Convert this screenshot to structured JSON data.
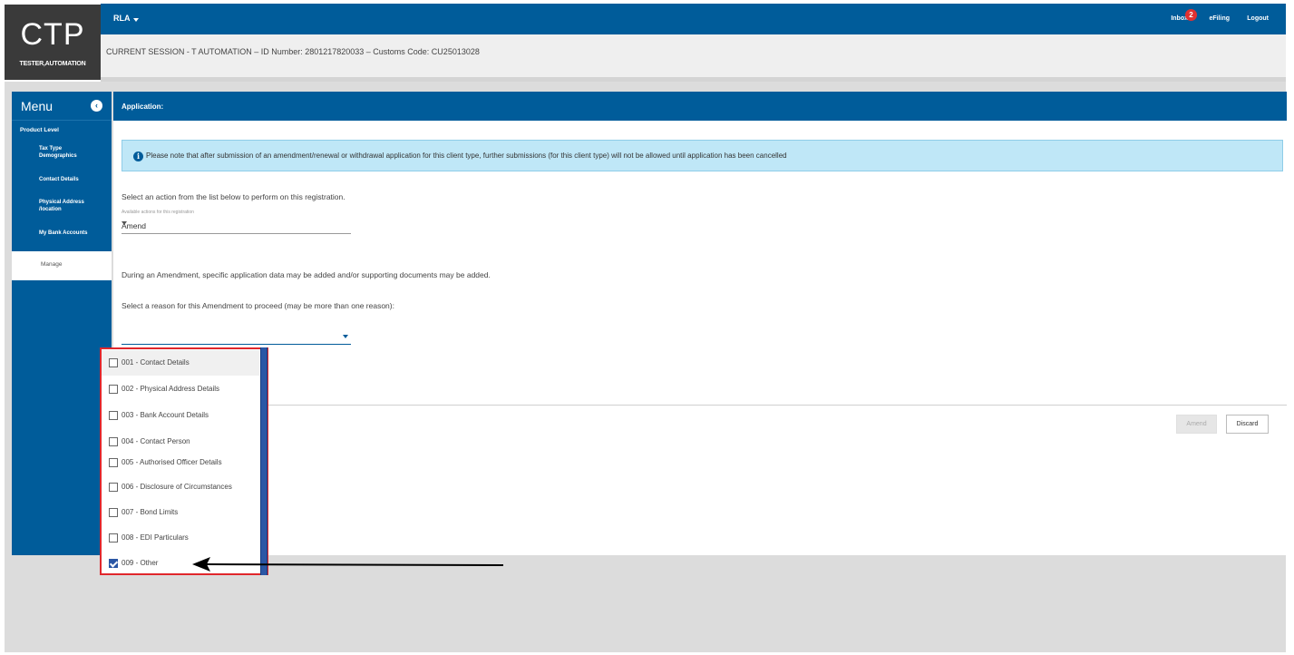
{
  "logo": {
    "brand": "CTP",
    "user": "TESTER,AUTOMATION"
  },
  "topbar": {
    "rla": "RLA",
    "inbox": "Inbox",
    "inbox_count": "2",
    "efiling": "eFiling",
    "logout": "Logout"
  },
  "session": {
    "text": "CURRENT SESSION - T AUTOMATION – ID Number: 2801217820033 – Customs Code: CU25013028"
  },
  "sidebar": {
    "title": "Menu",
    "section": "Product Level",
    "items": [
      {
        "label": "Tax Type Demographics"
      },
      {
        "label": "Contact Details"
      },
      {
        "label": "Physical Address /location"
      },
      {
        "label": "My Bank Accounts"
      },
      {
        "label": "Manage"
      }
    ]
  },
  "content": {
    "header": "Application:",
    "alert": "Please note that after submission of an amendment/renewal or withdrawal application for this client type, further submissions (for this client type) will not be allowed until application has been cancelled",
    "action_prompt": "Select an action from the list below to perform on this registration.",
    "action_help": "Available actions for this registration",
    "action_value": "Amend",
    "amend_note": "During an Amendment, specific application data may be added and/or supporting documents may be added.",
    "reason_prompt": "Select a reason for this Amendment to proceed (may be more than one reason):",
    "reason_value": ""
  },
  "buttons": {
    "amend": "Amend",
    "discard": "Discard"
  },
  "dropdown": {
    "options": [
      {
        "label": "001 - Contact Details",
        "checked": false
      },
      {
        "label": "002 - Physical Address Details",
        "checked": false
      },
      {
        "label": "003 - Bank Account Details",
        "checked": false
      },
      {
        "label": "004 - Contact Person",
        "checked": false
      },
      {
        "label": "005 - Authorised Officer Details",
        "checked": false
      },
      {
        "label": "006 - Disclosure of Circumstances",
        "checked": false
      },
      {
        "label": "007 - Bond Limits",
        "checked": false
      },
      {
        "label": "008 - EDI Particulars",
        "checked": false
      },
      {
        "label": "009 - Other",
        "checked": true
      }
    ]
  },
  "colors": {
    "primary": "#005c9a",
    "alert_bg": "#bfe7f7",
    "highlight_border": "#e0272c",
    "scrollbar": "#2b57a5"
  }
}
